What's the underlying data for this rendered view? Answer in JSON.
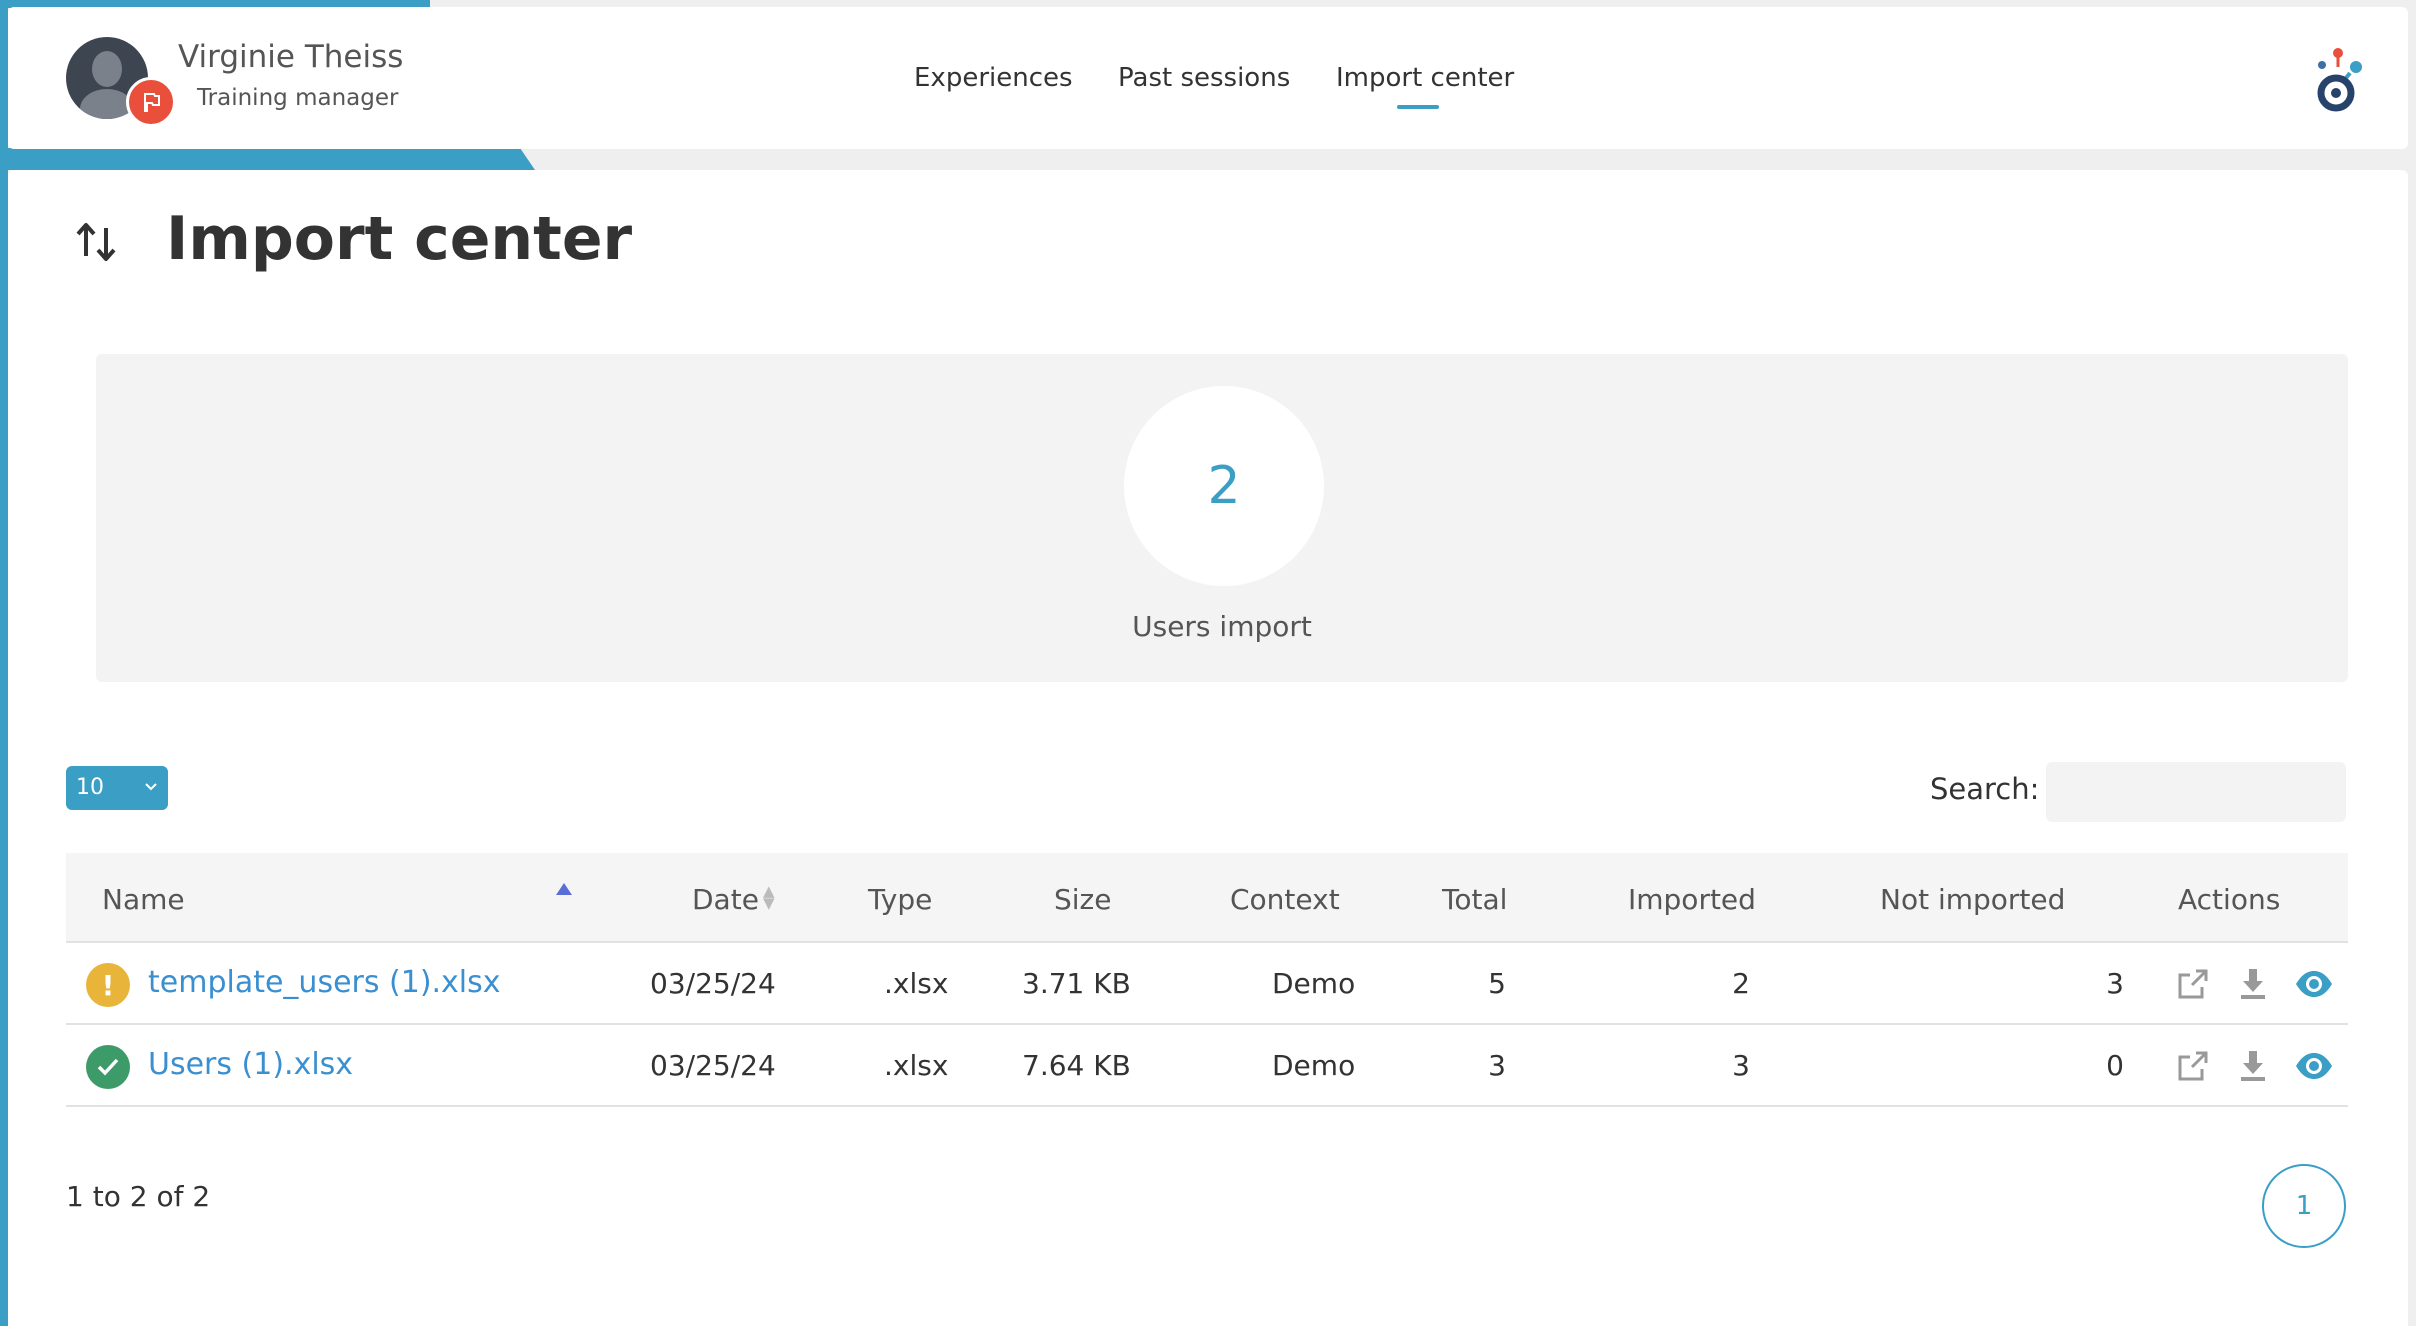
{
  "user": {
    "name": "Virginie Theiss",
    "role": "Training manager"
  },
  "nav": {
    "experiences": "Experiences",
    "past_sessions": "Past sessions",
    "import_center": "Import center",
    "active": "Import center"
  },
  "page": {
    "title": "Import center"
  },
  "stats": {
    "count": "2",
    "label": "Users import"
  },
  "controls": {
    "page_size": "10",
    "search_label": "Search:",
    "search_value": ""
  },
  "table": {
    "columns": [
      "Name",
      "Date",
      "Type",
      "Size",
      "Context",
      "Total",
      "Imported",
      "Not imported",
      "Actions"
    ],
    "rows": [
      {
        "status": "warning",
        "name": "template_users (1).xlsx",
        "date": "03/25/24",
        "type": ".xlsx",
        "size": "3.71 KB",
        "context": "Demo",
        "total": "5",
        "imported": "2",
        "not_imported": "3"
      },
      {
        "status": "success",
        "name": "Users (1).xlsx",
        "date": "03/25/24",
        "type": ".xlsx",
        "size": "7.64 KB",
        "context": "Demo",
        "total": "3",
        "imported": "3",
        "not_imported": "0"
      }
    ]
  },
  "pagination": {
    "info": "1 to 2 of 2",
    "current_page": "1"
  },
  "colors": {
    "accent": "#3a9ec5",
    "warning": "#e8b53a",
    "success": "#3d9b6a",
    "danger": "#e94f3b",
    "link": "#3a8fd0"
  },
  "icons": {
    "page": "import-export-arrows-icon",
    "role": "flag-icon",
    "actions": [
      "external-link-icon",
      "download-icon",
      "eye-icon"
    ],
    "status_warning": "exclamation-icon",
    "status_success": "check-icon"
  }
}
